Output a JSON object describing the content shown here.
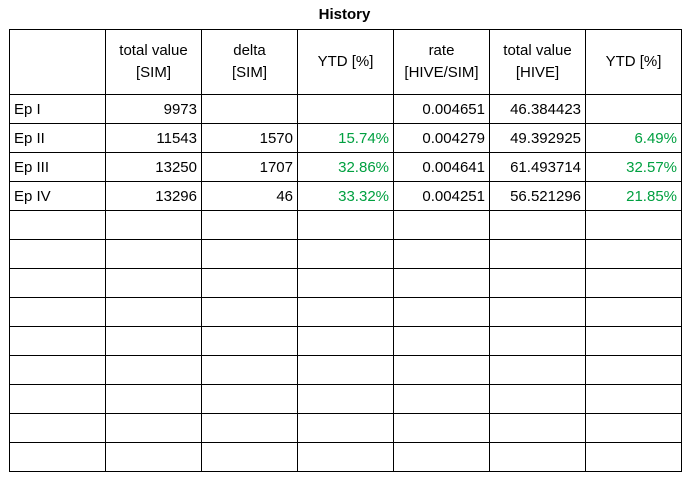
{
  "title": "History",
  "colors": {
    "positive_pct": "#00a040",
    "border": "#000000"
  },
  "headers": [
    {
      "line1": "total value",
      "line2": "[SIM]"
    },
    {
      "line1": "delta",
      "line2": "[SIM]"
    },
    {
      "line1": "YTD [%]",
      "line2": ""
    },
    {
      "line1": "rate",
      "line2": "[HIVE/SIM]"
    },
    {
      "line1": "total value",
      "line2": "[HIVE]"
    },
    {
      "line1": "YTD [%]",
      "line2": ""
    }
  ],
  "rows": [
    {
      "label": "Ep I",
      "total_sim": "9973",
      "delta_sim": "",
      "ytd_sim": "",
      "rate": "0.004651",
      "total_hive": "46.384423",
      "ytd_hive": ""
    },
    {
      "label": "Ep II",
      "total_sim": "11543",
      "delta_sim": "1570",
      "ytd_sim": "15.74%",
      "rate": "0.004279",
      "total_hive": "49.392925",
      "ytd_hive": "6.49%"
    },
    {
      "label": "Ep III",
      "total_sim": "13250",
      "delta_sim": "1707",
      "ytd_sim": "32.86%",
      "rate": "0.004641",
      "total_hive": "61.493714",
      "ytd_hive": "32.57%"
    },
    {
      "label": "Ep IV",
      "total_sim": "13296",
      "delta_sim": "46",
      "ytd_sim": "33.32%",
      "rate": "0.004251",
      "total_hive": "56.521296",
      "ytd_hive": "21.85%"
    }
  ],
  "empty_row_count": 9
}
